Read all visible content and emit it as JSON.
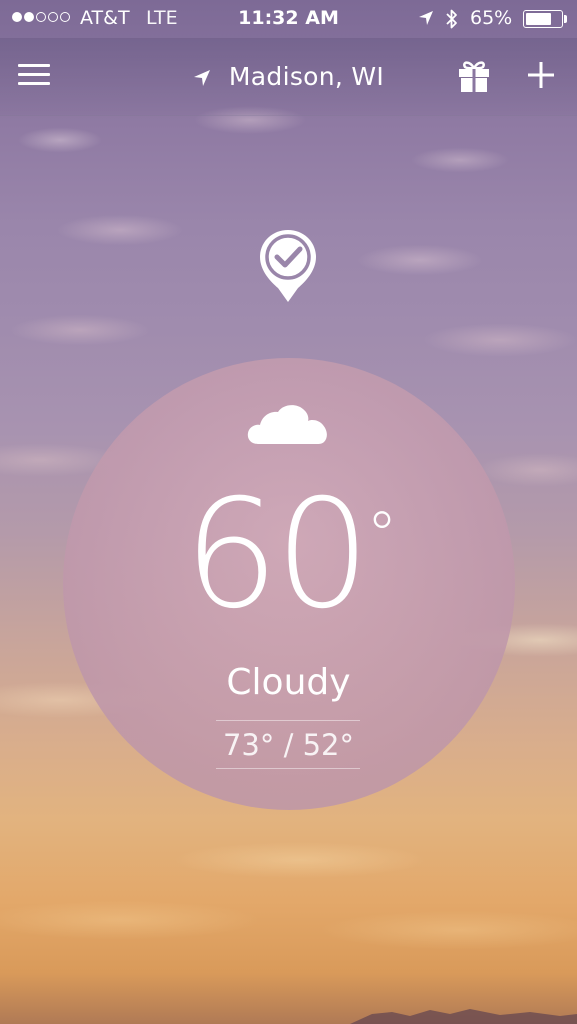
{
  "status_bar": {
    "signal_filled": 2,
    "signal_total": 5,
    "carrier": "AT&T",
    "network": "LTE",
    "time": "11:32 AM",
    "battery_percent": "65%",
    "battery_level": 0.65
  },
  "nav": {
    "location": "Madison, WI",
    "menu_icon": "hamburger-menu-icon",
    "location_icon": "location-arrow-icon",
    "gift_icon": "gift-icon",
    "add_icon": "plus-icon"
  },
  "checkin": {
    "icon": "checkmark-pin-icon"
  },
  "weather": {
    "condition_icon": "cloud-icon",
    "temperature": "60",
    "degree_symbol": "°",
    "condition": "Cloudy",
    "high_low": "73° / 52°"
  },
  "colors": {
    "text": "#ffffff",
    "circle": "#c9a2b4",
    "sky_top": "#7d6a96",
    "sky_bottom": "#e3a86a"
  }
}
